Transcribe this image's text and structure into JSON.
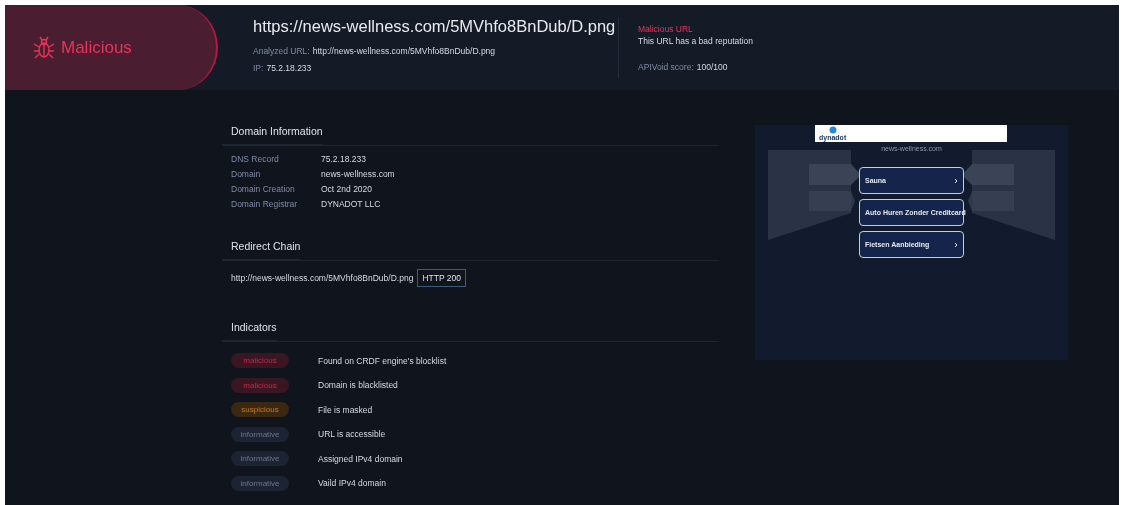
{
  "verdict": {
    "label": "Malicious"
  },
  "header": {
    "url": "https://news-wellness.com/5MVhfo8BnDub/D.png",
    "analyzed_label": "Analyzed URL:",
    "analyzed_url": "http://news-wellness.com/5MVhfo8BnDub/D.png",
    "ip_label": "IP:",
    "ip": "75.2.18.233"
  },
  "reputation": {
    "title": "Malicious URL",
    "description": "This URL has a bad reputation",
    "score_label": "APIVoid score:",
    "score": "100/100"
  },
  "domain_information": {
    "title": "Domain Information",
    "rows": [
      {
        "label": "DNS Record",
        "value": "75.2.18.233"
      },
      {
        "label": "Domain",
        "value": "news-wellness.com"
      },
      {
        "label": "Domain Creation",
        "value": "Oct 2nd 2020"
      },
      {
        "label": "Domain Registrar",
        "value": "DYNADOT LLC"
      }
    ]
  },
  "redirect_chain": {
    "title": "Redirect Chain",
    "entries": [
      {
        "url": "http://news-wellness.com/5MVhfo8BnDub/D.png",
        "status": "HTTP 200"
      }
    ]
  },
  "indicators": {
    "title": "Indicators",
    "items": [
      {
        "severity": "malicious",
        "text": "Found on CRDF engine's blocklist"
      },
      {
        "severity": "malicious",
        "text": "Domain is blacklisted"
      },
      {
        "severity": "suspicious",
        "text": "File is masked"
      },
      {
        "severity": "informative",
        "text": "URL is accessible"
      },
      {
        "severity": "informative",
        "text": "Assigned IPv4 domain"
      },
      {
        "severity": "informative",
        "text": "Vaild IPv4 domain"
      }
    ]
  },
  "preview": {
    "brand": "dynadot",
    "domain": "news-wellness.com",
    "links": [
      "Sauna",
      "Auto Huren Zonder Creditcard",
      "Fietsen Aanbieding"
    ]
  }
}
